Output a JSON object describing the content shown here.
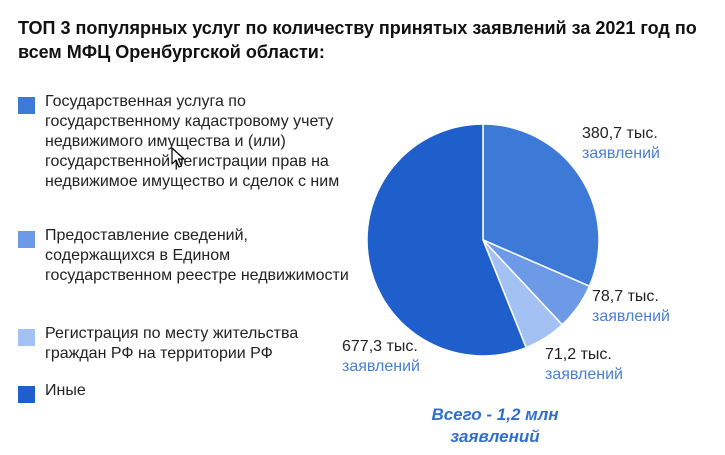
{
  "title": "ТОП 3 популярных услуг по количеству принятых заявлений за 2021 год по всем МФЦ Оренбургской области:",
  "chart_data": {
    "type": "pie",
    "slices": [
      {
        "label": "Государственная услуга по государственному кадастровому учету недвижимого имущества и (или) государственной регистрации прав на недвижимое имущество и сделок с ним",
        "value": 380.7,
        "value_text": "380,7 тыс.",
        "unit_text": "заявлений",
        "color": "#3d7ad8"
      },
      {
        "label": "Предоставление сведений, содержащихся в Едином государственном реестре недвижимости",
        "value": 78.7,
        "value_text": "78,7 тыс.",
        "unit_text": "заявлений",
        "color": "#6d9ae6"
      },
      {
        "label": "Регистрация по месту жительства граждан РФ на территории РФ",
        "value": 71.2,
        "value_text": "71,2 тыс.",
        "unit_text": "заявлений",
        "color": "#a3c1f2"
      },
      {
        "label": "Иные",
        "value": 677.3,
        "value_text": "677,3 тыс.",
        "unit_text": "заявлений",
        "color": "#1f5fcc"
      }
    ],
    "total_text": "Всего - 1,2 млн заявлений"
  }
}
